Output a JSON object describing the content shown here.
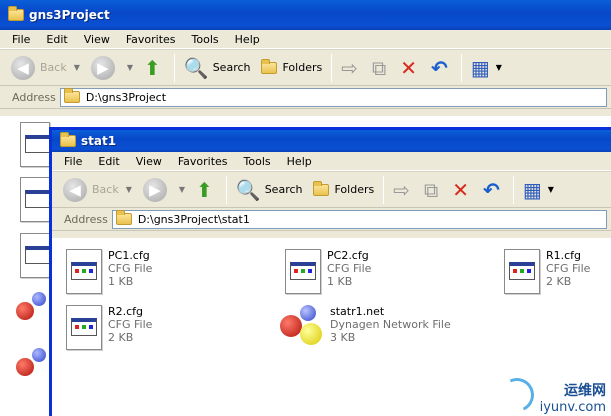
{
  "back_window": {
    "title": "gns3Project",
    "menu": [
      "File",
      "Edit",
      "View",
      "Favorites",
      "Tools",
      "Help"
    ],
    "toolbar": {
      "back": "Back",
      "search": "Search",
      "folders": "Folders"
    },
    "address_label": "Address",
    "address_value": "D:\\gns3Project"
  },
  "front_window": {
    "title": "stat1",
    "menu": [
      "File",
      "Edit",
      "View",
      "Favorites",
      "Tools",
      "Help"
    ],
    "toolbar": {
      "back": "Back",
      "search": "Search",
      "folders": "Folders"
    },
    "address_label": "Address",
    "address_value": "D:\\gns3Project\\stat1",
    "files": [
      {
        "name": "PC1.cfg",
        "type": "CFG File",
        "size": "1 KB"
      },
      {
        "name": "PC2.cfg",
        "type": "CFG File",
        "size": "1 KB"
      },
      {
        "name": "R1.cfg",
        "type": "CFG File",
        "size": "2 KB"
      },
      {
        "name": "R2.cfg",
        "type": "CFG File",
        "size": "2 KB"
      },
      {
        "name": "statr1.net",
        "type": "Dynagen Network File",
        "size": "3 KB"
      }
    ]
  },
  "watermark": {
    "line1": "运维网",
    "line2": "iyunv.com"
  },
  "icons": {
    "back": "back-arrow-icon",
    "forward": "forward-arrow-icon",
    "up": "up-folder-icon",
    "search": "search-icon",
    "folders": "folders-icon",
    "move": "move-to-icon",
    "copy": "copy-to-icon",
    "delete": "delete-icon",
    "undo": "undo-icon",
    "views": "views-icon"
  }
}
